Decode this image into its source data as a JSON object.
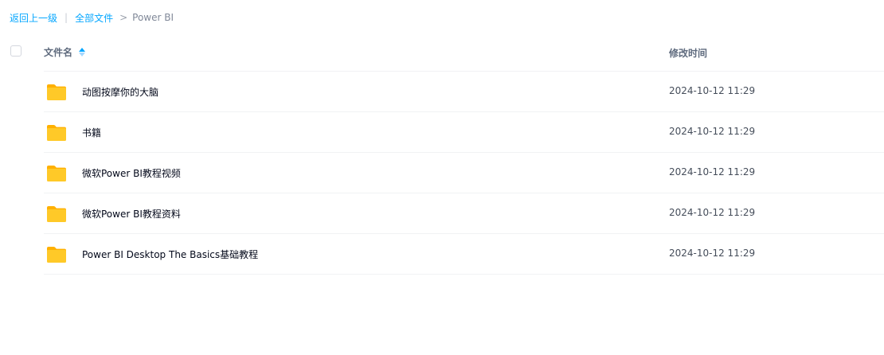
{
  "breadcrumb": {
    "back_label": "返回上一级",
    "separator": "|",
    "root_label": "全部文件",
    "arrow": ">",
    "current_label": "Power BI"
  },
  "table": {
    "col_name": "文件名",
    "col_time": "修改时间",
    "sort_icon": "sort-ascending-icon",
    "rows": [
      {
        "name": "动图按摩你的大脑",
        "time": "2024-10-12 11:29",
        "icon": "folder-icon"
      },
      {
        "name": "书籍",
        "time": "2024-10-12 11:29",
        "icon": "folder-icon"
      },
      {
        "name": "微软Power BI教程视频",
        "time": "2024-10-12 11:29",
        "icon": "folder-icon"
      },
      {
        "name": "微软Power BI教程资料",
        "time": "2024-10-12 11:29",
        "icon": "folder-icon"
      },
      {
        "name": "Power BI Desktop The Basics基础教程",
        "time": "2024-10-12 11:29",
        "icon": "folder-icon"
      }
    ]
  },
  "colors": {
    "accent": "#06a7ff",
    "folder": "#ffc21a",
    "divider": "#f1f2f4"
  }
}
